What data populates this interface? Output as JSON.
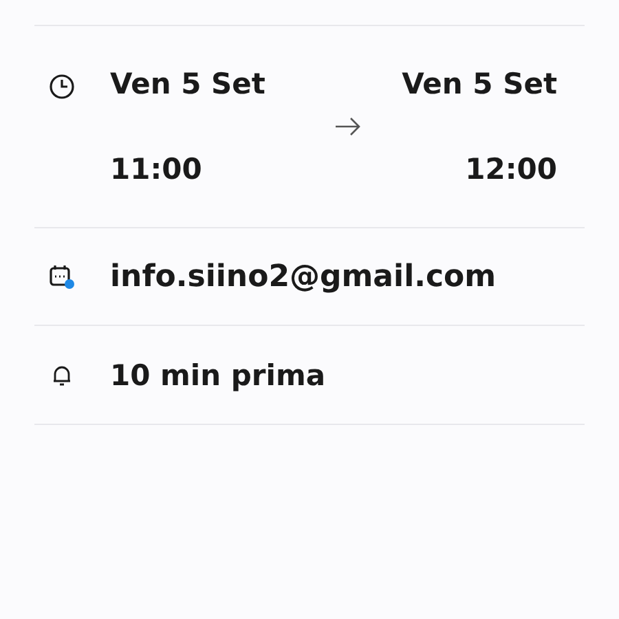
{
  "time": {
    "start": {
      "date": "Ven 5 Set",
      "time": "11:00"
    },
    "end": {
      "date": "Ven 5 Set",
      "time": "12:00"
    }
  },
  "calendar": {
    "account": "info.siino2@gmail.com",
    "color": "#1e88e5"
  },
  "reminder": {
    "label": "10 min prima"
  }
}
